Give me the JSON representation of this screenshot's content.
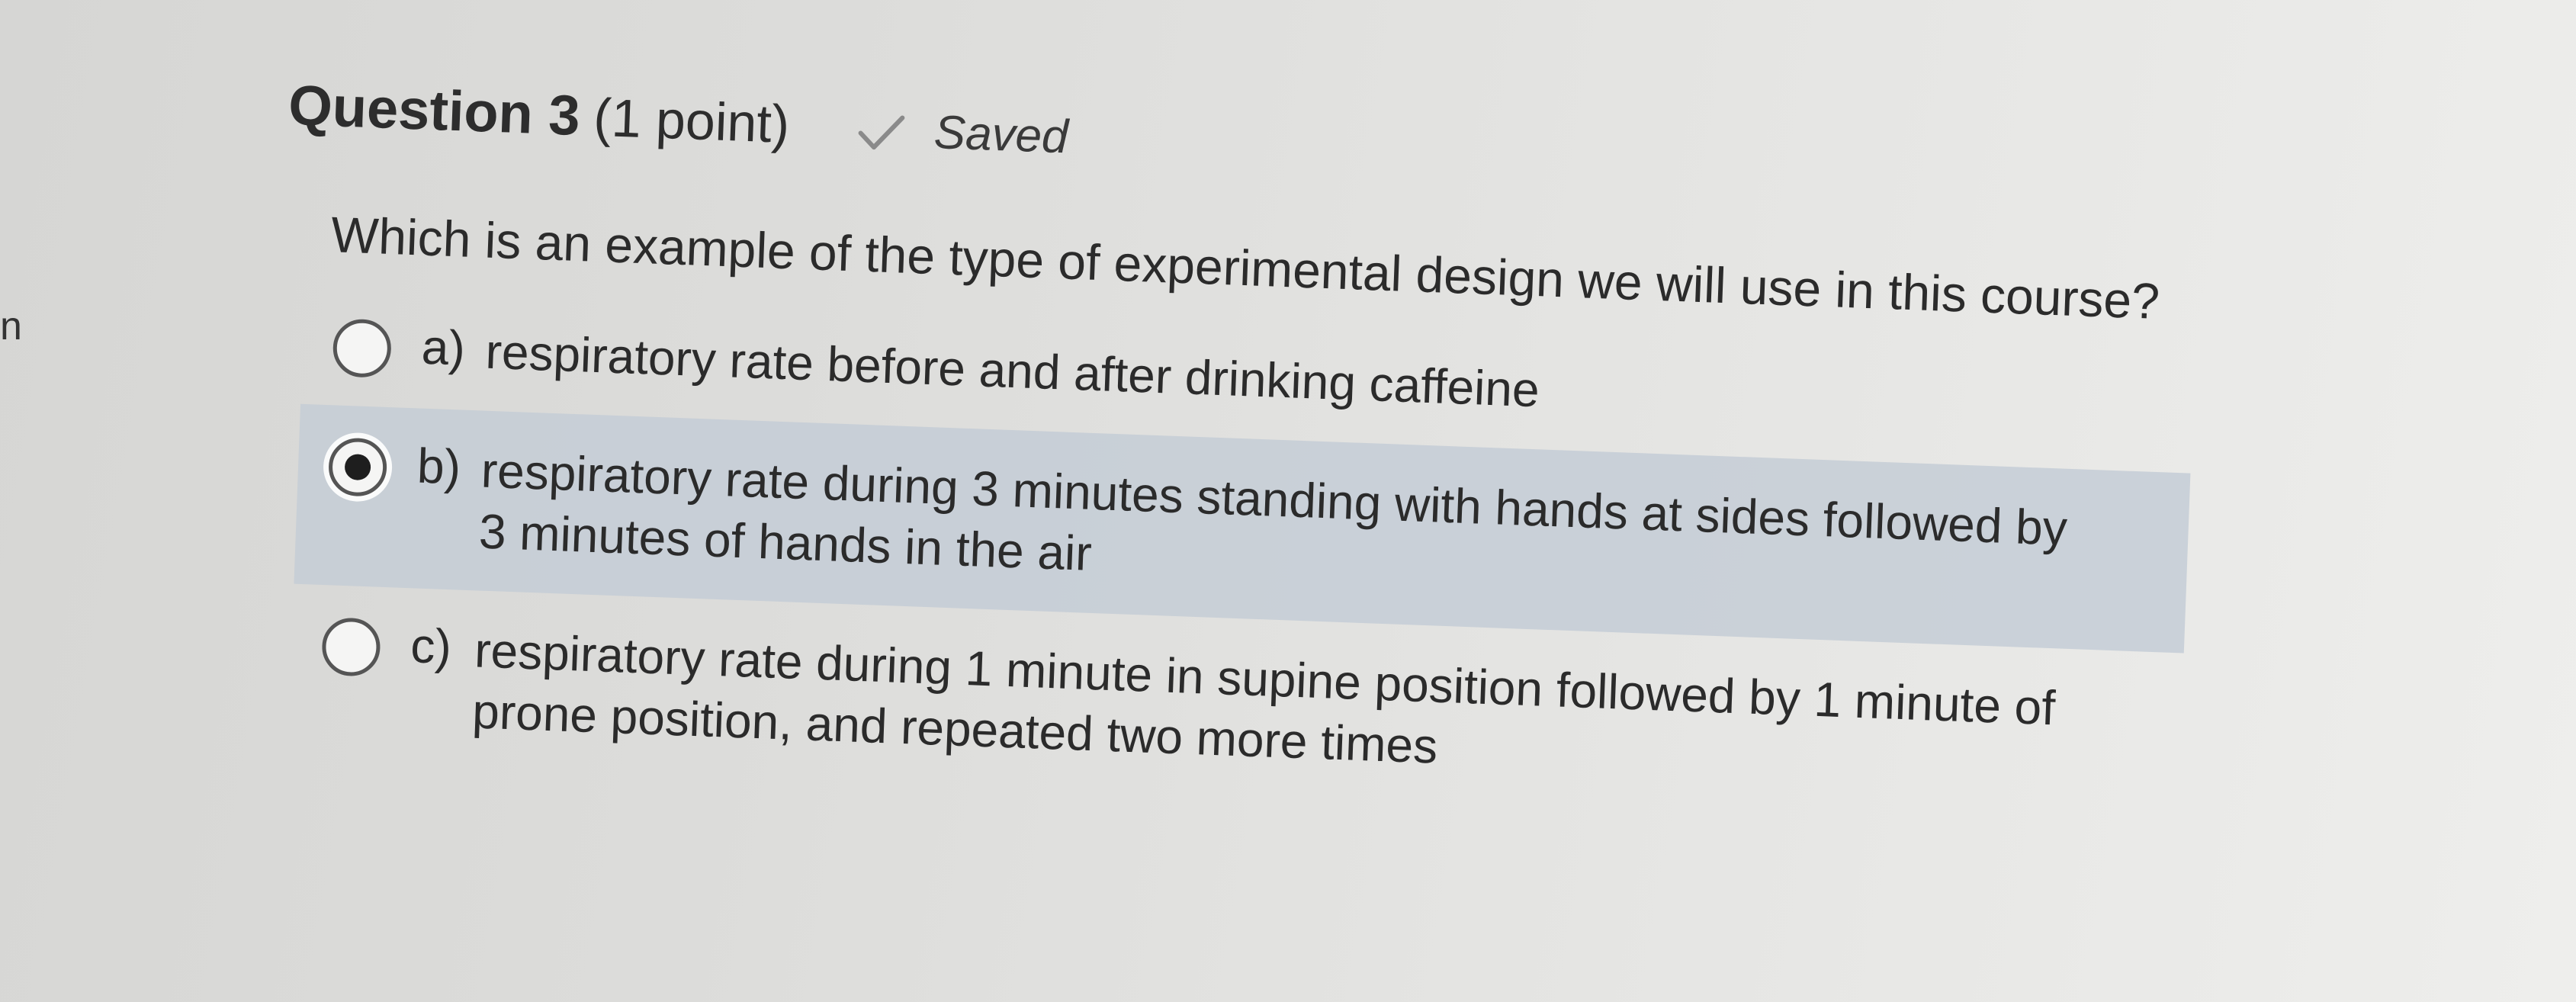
{
  "left_edge": {
    "text": "n"
  },
  "question": {
    "title": "Question 3",
    "points": "(1 point)",
    "status": {
      "icon": "checkmark-icon",
      "label": "Saved"
    },
    "prompt": "Which is an example of the type of experimental design we will use in this course?",
    "options": [
      {
        "letter": "a)",
        "text": "respiratory rate before and after drinking caffeine",
        "selected": false
      },
      {
        "letter": "b)",
        "text": "respiratory rate during 3 minutes standing with hands at sides followed by 3 minutes of hands in the air",
        "selected": true
      },
      {
        "letter": "c)",
        "text": "respiratory rate during 1 minute in supine position followed by 1 minute of prone position, and repeated two more times",
        "selected": false
      }
    ]
  },
  "colors": {
    "selected_background": "#c4ccd6",
    "text": "#2b2b2b",
    "check": "#8a8a8a"
  }
}
